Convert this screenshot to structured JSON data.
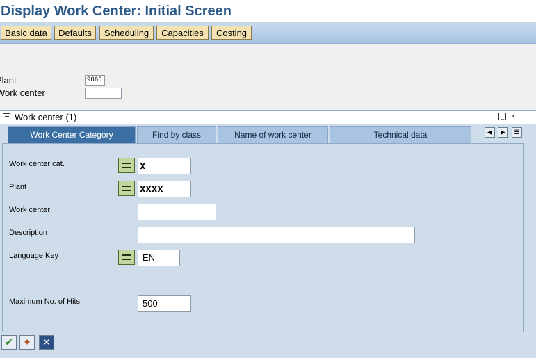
{
  "title": "Display Work Center: Initial Screen",
  "toolbar": {
    "buttons": [
      "Basic data",
      "Defaults",
      "Scheduling",
      "Capacities",
      "Costing"
    ]
  },
  "main": {
    "plant_label": "Plant",
    "plant_value": "9060",
    "work_center_label": "Work center",
    "work_center_value": ""
  },
  "dialog": {
    "title": "Work center (1)",
    "tabs": [
      "Work Center Category",
      "Find by class",
      "Name of work center",
      "Technical data"
    ],
    "fields": {
      "category": {
        "label": "Work center cat.",
        "value": "x"
      },
      "plant": {
        "label": "Plant",
        "value": "xxxx"
      },
      "work_center": {
        "label": "Work center",
        "value": ""
      },
      "description": {
        "label": "Description",
        "value": ""
      },
      "language": {
        "label": "Language Key",
        "value": "EN"
      },
      "max_hits": {
        "label": "Maximum No. of Hits",
        "value": "500"
      }
    }
  },
  "icons": {
    "confirm": "check-icon",
    "options": "multiple-selection-icon",
    "cancel": "cancel-icon"
  },
  "colors": {
    "title": "#2c5a8a",
    "toolbar_button": "#f4e3b1",
    "active_tab": "#3b6fa3",
    "panel": "#cfdce9"
  }
}
